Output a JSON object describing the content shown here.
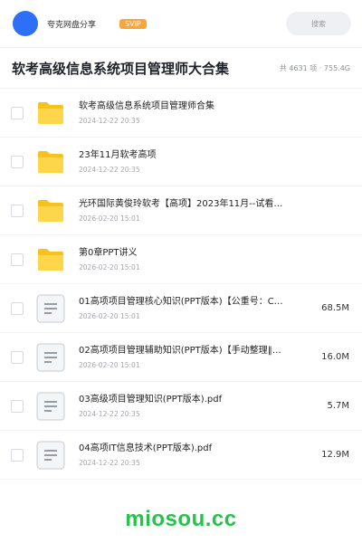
{
  "header": {
    "site_name": "夸克网盘分享",
    "badge": "SVIP",
    "search_placeholder": "搜索"
  },
  "folder_title": "软考高级信息系统项目管理师大合集",
  "folder_meta": "共 4631 项 · 755.4G",
  "files": [
    {
      "type": "folder",
      "name": "软考高级信息系统项目管理师合集",
      "date": "2024-12-22 20:35",
      "size": ""
    },
    {
      "type": "folder",
      "name": "23年11月软考高项",
      "date": "2024-12-22 20:35",
      "size": ""
    },
    {
      "type": "folder",
      "name": "光环国际黄俊玲软考【高项】2023年11月--试看…",
      "date": "2026-02-20 15:01",
      "size": ""
    },
    {
      "type": "folder",
      "name": "第0章PPT讲义",
      "date": "2026-02-20 15:01",
      "size": ""
    },
    {
      "type": "doc",
      "name": "01高项项目管理核心知识(PPT版本)【公重号：C…",
      "date": "2026-02-20 15:01",
      "size": "68.5M"
    },
    {
      "type": "doc",
      "name": "02高项项目管理辅助知识(PPT版本)【手动整理‖…",
      "date": "2026-02-20 15:01",
      "size": "16.0M"
    },
    {
      "type": "doc",
      "name": "03高级项目管理知识(PPT版本).pdf",
      "date": "2024-12-22 20:35",
      "size": "5.7M"
    },
    {
      "type": "doc",
      "name": "04高项IT信息技术(PPT版本).pdf",
      "date": "2024-12-22 20:35",
      "size": "12.9M"
    }
  ],
  "footer": {
    "brand": "miosou.cc"
  },
  "colors": {
    "brand": "#27c24c",
    "folder": "#f9c21a",
    "avatar": "#2e6ff7",
    "svip": "#f8a53c"
  }
}
